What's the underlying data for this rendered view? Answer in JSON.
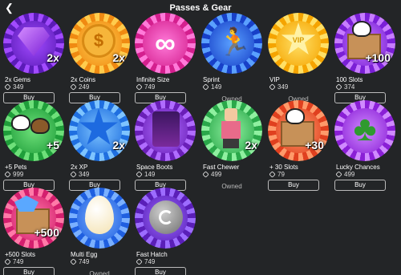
{
  "header": {
    "title": "Passes & Gear",
    "back_icon": "chevron-left-icon"
  },
  "items": [
    {
      "name": "2x Gems",
      "price": "349",
      "state": "buy",
      "multiplier": "2x",
      "colors": [
        "#5b1bb8",
        "#a24bff"
      ]
    },
    {
      "name": "2x Coins",
      "price": "249",
      "state": "buy",
      "multiplier": "2x",
      "colors": [
        "#f08a12",
        "#ffcc4d"
      ]
    },
    {
      "name": "Infinite Size",
      "price": "749",
      "state": "buy",
      "multiplier": "",
      "colors": [
        "#d41f8e",
        "#ff7ad9"
      ]
    },
    {
      "name": "Sprint",
      "price": "149",
      "state": "owned",
      "multiplier": "",
      "colors": [
        "#1740c8",
        "#5aa0ff"
      ]
    },
    {
      "name": "VIP",
      "price": "349",
      "state": "owned",
      "multiplier": "",
      "colors": [
        "#f5a400",
        "#ffe066"
      ]
    },
    {
      "name": "100 Slots",
      "price": "374",
      "state": "buy",
      "multiplier": "+100",
      "colors": [
        "#7a1fd6",
        "#c77dff"
      ]
    },
    {
      "name": "+5 Pets",
      "price": "999",
      "state": "buy",
      "multiplier": "+5",
      "colors": [
        "#1f9e3a",
        "#6ee07a"
      ]
    },
    {
      "name": "2x XP",
      "price": "349",
      "state": "buy",
      "multiplier": "2x",
      "colors": [
        "#1f6fe0",
        "#7ec4ff"
      ]
    },
    {
      "name": "Space Boots",
      "price": "149",
      "state": "buy",
      "multiplier": "",
      "colors": [
        "#6a1fb8",
        "#b06cff"
      ]
    },
    {
      "name": "Fast Chewer",
      "price": "499",
      "state": "owned",
      "multiplier": "2x",
      "colors": [
        "#2aa84a",
        "#8ff0a0"
      ]
    },
    {
      "name": "+ 30 Slots",
      "price": "79",
      "state": "buy",
      "multiplier": "+30",
      "colors": [
        "#e0401f",
        "#ff9a6a"
      ]
    },
    {
      "name": "Lucky Chances",
      "price": "499",
      "state": "buy",
      "multiplier": "",
      "colors": [
        "#8a1fd6",
        "#d08aff"
      ]
    },
    {
      "name": "+500 Slots",
      "price": "749",
      "state": "buy",
      "multiplier": "+500",
      "colors": [
        "#d41f6e",
        "#ff7aa8"
      ]
    },
    {
      "name": "Multi Egg",
      "price": "749",
      "state": "owned",
      "multiplier": "",
      "colors": [
        "#1f5fe0",
        "#7ab0ff"
      ]
    },
    {
      "name": "Fast Hatch",
      "price": "749",
      "state": "buy",
      "multiplier": "",
      "colors": [
        "#5a1fb8",
        "#9c6cff"
      ]
    }
  ],
  "labels": {
    "buy": "Buy",
    "owned": "Owned"
  },
  "icons": [
    "gem-icon",
    "coin-icon",
    "infinity-icon",
    "runner-icon",
    "vip-star-icon",
    "box-pets-icon",
    "pets-icon",
    "star-icon",
    "boots-icon",
    "character-icon",
    "box-pets-icon",
    "clover-icon",
    "box-crystal-icon",
    "egg-icon",
    "hatch-icon"
  ]
}
